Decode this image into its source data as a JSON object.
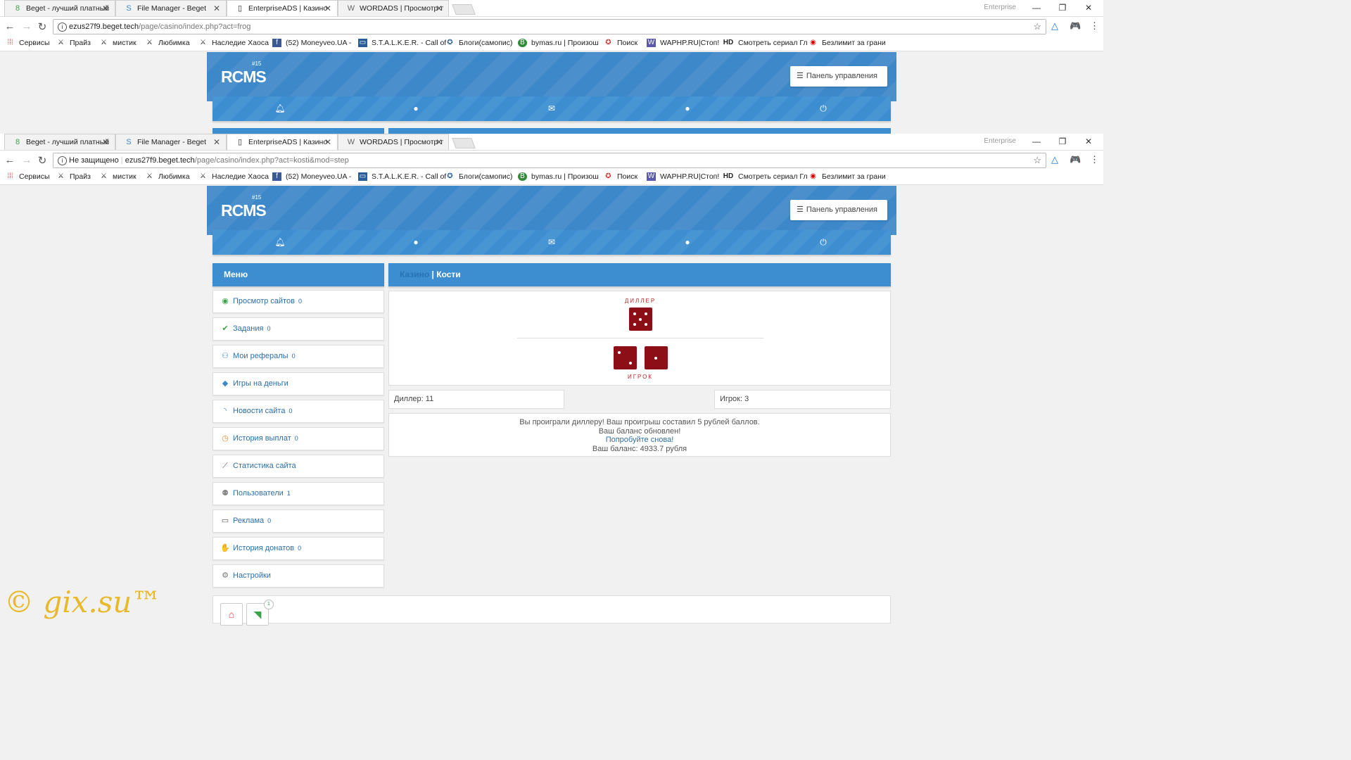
{
  "window1": {
    "tabs": [
      "Beget - лучший платный",
      "File Manager - Beget",
      "EnterpriseADS | Казино",
      "WORDADS | Просмотр т"
    ],
    "enterprise": "Enterprise",
    "url_host": "ezus27f9.beget.tech",
    "url_path": "/page/casino/index.php?act=frog"
  },
  "window2": {
    "tabs": [
      "Beget - лучший платный",
      "File Manager - Beget",
      "EnterpriseADS | Казино",
      "WORDADS | Просмотр т"
    ],
    "enterprise": "Enterprise",
    "security": "Не защищено",
    "url_host": "ezus27f9.beget.tech",
    "url_path": "/page/casino/index.php?act=kosti&mod=step"
  },
  "bookmarks": [
    "Сервисы",
    "Прайз",
    "мистик",
    "Любимка",
    "Наследие Хаоса",
    "(52) Moneyveo.UA -",
    "S.T.A.L.K.E.R. - Call of",
    "Блоги(самопис)",
    "bymas.ru | Произош",
    "Поиск",
    "WAPHP.RU|Стоп!",
    "Смотреть сериал Гл",
    "Безлимит за грани"
  ],
  "site": {
    "logo": "RCMS",
    "logo_version": "#15",
    "panel_button": "Панель управления",
    "menu_title": "Меню",
    "content_title_link": "Казино",
    "content_title_sep": " | ",
    "content_title": "Кости",
    "menu": [
      {
        "label": "Просмотр сайтов",
        "count": "0",
        "icon": "eye-icon",
        "color": "#3aa34a"
      },
      {
        "label": "Задания",
        "count": "0",
        "icon": "check-icon",
        "color": "#3aa34a"
      },
      {
        "label": "Мои рефералы",
        "count": "0",
        "icon": "users-icon",
        "color": "#3d88c8"
      },
      {
        "label": "Игры на деньги",
        "count": "",
        "icon": "gamepad-icon",
        "color": "#3d88c8"
      },
      {
        "label": "Новости сайта",
        "count": "0",
        "icon": "rss-icon",
        "color": "#3d88c8"
      },
      {
        "label": "История выплат",
        "count": "0",
        "icon": "history-icon",
        "color": "#e8862a"
      },
      {
        "label": "Статистика сайта",
        "count": "",
        "icon": "chart-icon",
        "color": "#555555"
      },
      {
        "label": "Пользователи",
        "count": "1",
        "icon": "people-icon",
        "color": "#888888"
      },
      {
        "label": "Реклама",
        "count": "0",
        "icon": "monitor-icon",
        "color": "#555555"
      },
      {
        "label": "История донатов",
        "count": "0",
        "icon": "donate-icon",
        "color": "#e8862a"
      },
      {
        "label": "Настройки",
        "count": "",
        "icon": "gear-icon",
        "color": "#777777"
      }
    ],
    "game": {
      "dealer_label": "ДИЛЛЕР",
      "player_label": "ИГРОК",
      "dealer_dice": [
        5
      ],
      "player_dice": [
        2,
        1
      ],
      "dealer_score": "Диллер: 11",
      "player_score": "Игрок: 3",
      "result_line1": "Вы проиграли диллеру! Ваш проигрыш составил 5 рублей баллов.",
      "result_line2": "Ваш баланс обновлен!",
      "result_link": "Попробуйте снова!",
      "result_balance": "Ваш баланс: 4933.7 рубля"
    },
    "footer_badge": "1"
  },
  "watermark": "© gix.su™"
}
